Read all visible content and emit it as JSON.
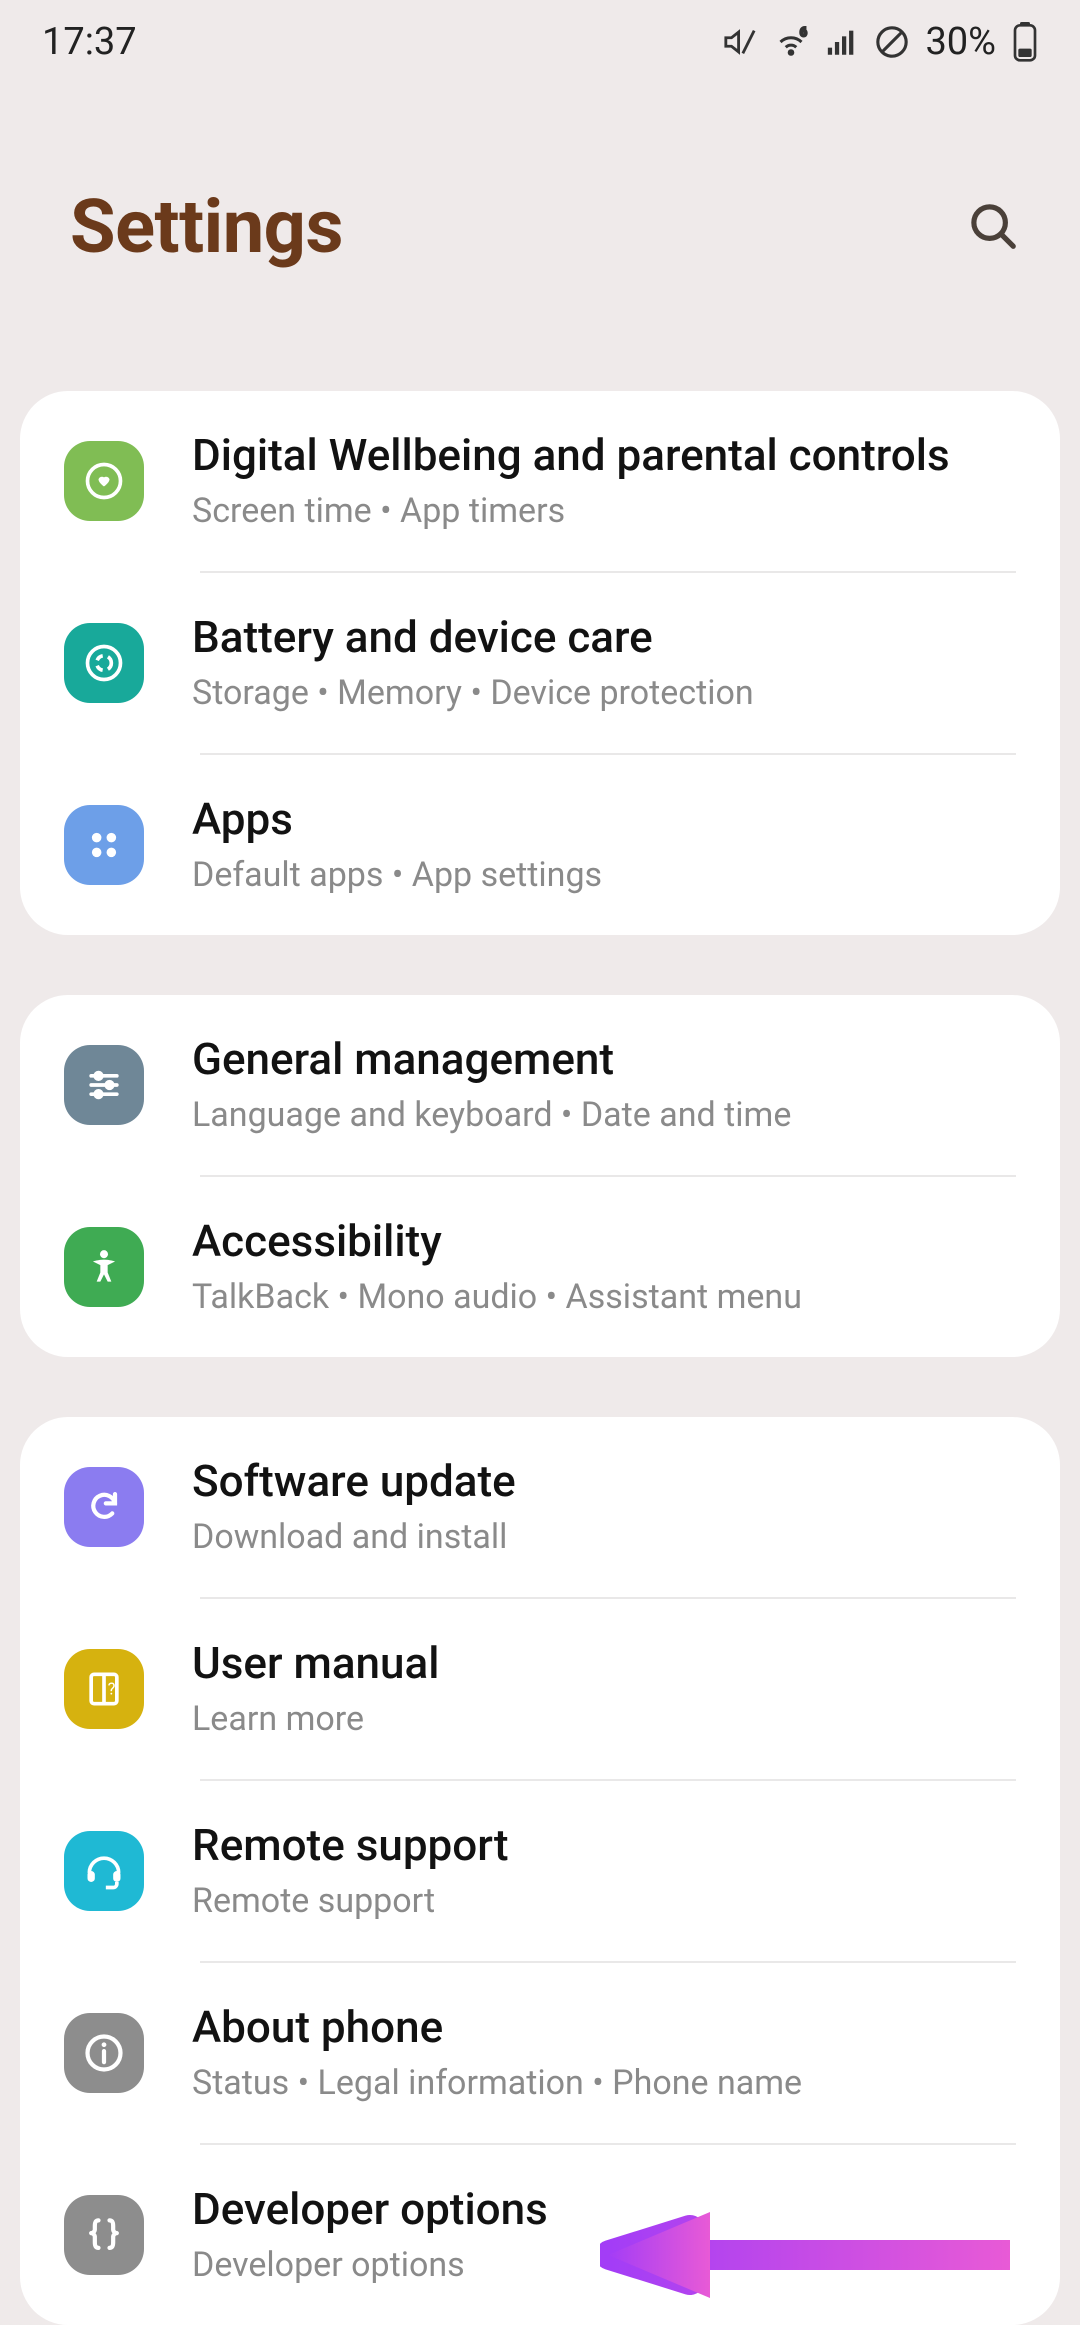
{
  "status": {
    "time": "17:37",
    "battery_text": "30%"
  },
  "header": {
    "title": "Settings"
  },
  "groups": [
    {
      "items": [
        {
          "id": "digital-wellbeing",
          "title": "Digital Wellbeing and parental controls",
          "subtitle": "Screen time  •  App timers",
          "icon": "heart-circle-icon",
          "color": "#80bd54"
        },
        {
          "id": "battery-device-care",
          "title": "Battery and device care",
          "subtitle": "Storage  •  Memory  •  Device protection",
          "icon": "device-care-icon",
          "color": "#18a99a"
        },
        {
          "id": "apps",
          "title": "Apps",
          "subtitle": "Default apps  •  App settings",
          "icon": "apps-icon",
          "color": "#6d9fe8"
        }
      ]
    },
    {
      "items": [
        {
          "id": "general-management",
          "title": "General management",
          "subtitle": "Language and keyboard  •  Date and time",
          "icon": "sliders-icon",
          "color": "#6f8797"
        },
        {
          "id": "accessibility",
          "title": "Accessibility",
          "subtitle": "TalkBack  •  Mono audio  •  Assistant menu",
          "icon": "accessibility-icon",
          "color": "#3fab53"
        }
      ]
    },
    {
      "items": [
        {
          "id": "software-update",
          "title": "Software update",
          "subtitle": "Download and install",
          "icon": "update-icon",
          "color": "#8b7cf0"
        },
        {
          "id": "user-manual",
          "title": "User manual",
          "subtitle": "Learn more",
          "icon": "manual-icon",
          "color": "#d6b20f"
        },
        {
          "id": "remote-support",
          "title": "Remote support",
          "subtitle": "Remote support",
          "icon": "headset-icon",
          "color": "#1fb9d4"
        },
        {
          "id": "about-phone",
          "title": "About phone",
          "subtitle": "Status  •  Legal information  •  Phone name",
          "icon": "info-icon",
          "color": "#8d8d8d"
        },
        {
          "id": "developer-options",
          "title": "Developer options",
          "subtitle": "Developer options",
          "icon": "braces-icon",
          "color": "#8d8d8d"
        }
      ]
    }
  ]
}
